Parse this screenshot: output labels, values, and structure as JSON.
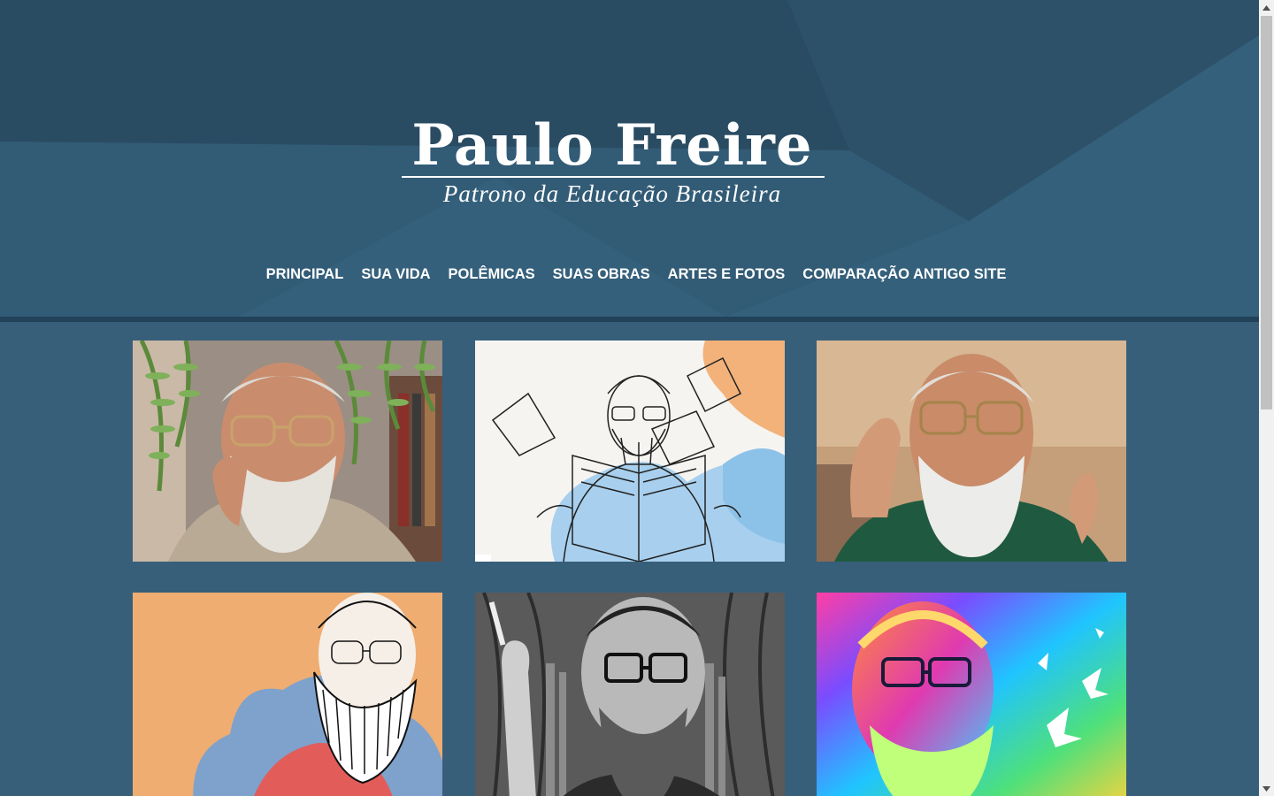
{
  "site": {
    "title": "Paulo Freire",
    "subtitle": "Patrono da Educação Brasileira"
  },
  "nav": {
    "items": [
      {
        "label": "PRINCIPAL"
      },
      {
        "label": "SUA VIDA"
      },
      {
        "label": "POLÊMICAS"
      },
      {
        "label": "SUAS OBRAS"
      },
      {
        "label": "ARTES E FOTOS"
      },
      {
        "label": "COMPARAÇÃO ANTIGO SITE"
      }
    ]
  },
  "gallery": {
    "photos": [
      {
        "name": "photo-portrait-fern"
      },
      {
        "name": "photo-sketch-book"
      },
      {
        "name": "photo-smiling-green-shirt"
      },
      {
        "name": "photo-illustration-orange"
      },
      {
        "name": "photo-bw-cigarette"
      },
      {
        "name": "photo-rainbow-art-doves"
      }
    ]
  },
  "colors": {
    "header_bg": "#2f5670",
    "page_bg": "#375f7a",
    "header_rule": "#22425a",
    "text": "#ffffff"
  }
}
